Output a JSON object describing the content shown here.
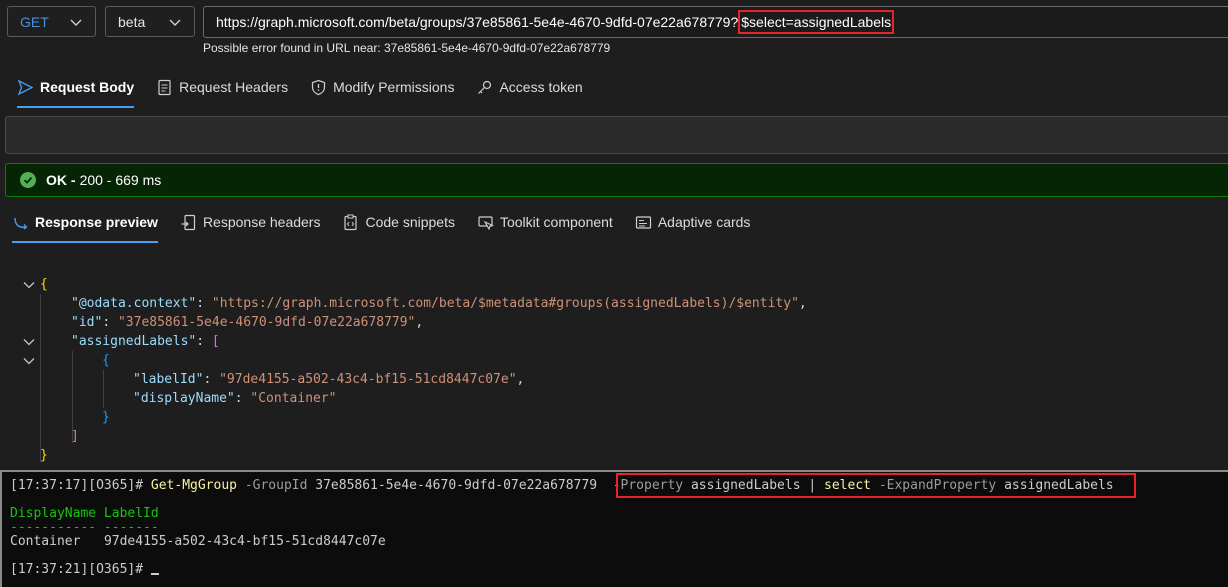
{
  "request": {
    "method": "GET",
    "version": "beta",
    "url_base": "https://graph.microsoft.com/beta/groups/37e85861-5e4e-4670-9dfd-07e22a678779?",
    "url_query": "$select=assignedLabels",
    "error_hint": "Possible error found in URL near: 37e85861-5e4e-4670-9dfd-07e22a678779"
  },
  "request_tabs": [
    "Request Body",
    "Request Headers",
    "Modify Permissions",
    "Access token"
  ],
  "status": {
    "bold": "OK -",
    "text": "200 - 669 ms"
  },
  "response_tabs": [
    "Response preview",
    "Response headers",
    "Code snippets",
    "Toolkit component",
    "Adaptive cards"
  ],
  "json": {
    "open": "{",
    "ctx_key": "\"@odata.context\"",
    "ctx_val": "\"https://graph.microsoft.com/beta/$metadata#groups(assignedLabels)/$entity\"",
    "id_key": "\"id\"",
    "id_val": "\"37e85861-5e4e-4670-9dfd-07e22a678779\"",
    "labels_key": "\"assignedLabels\"",
    "arr_open": "[",
    "obj_open": "{",
    "labelId_key": "\"labelId\"",
    "labelId_val": "\"97de4155-a502-43c4-bf15-51cd8447c07e\"",
    "dn_key": "\"displayName\"",
    "dn_val": "\"Container\"",
    "obj_close": "}",
    "arr_close": "]",
    "close": "}"
  },
  "terminal": {
    "prompt1": "[17:37:17][O365]# ",
    "cmd": "Get-MgGroup",
    "param1": "-GroupId",
    "arg1": "37e85861-5e4e-4670-9dfd-07e22a678779",
    "param2": "-Property",
    "arg2": "assignedLabels",
    "pipe": "|",
    "cmd2": "select",
    "param3": "-ExpandProperty",
    "arg3": "assignedLabels",
    "header": "DisplayName LabelId",
    "underline": "----------- -------",
    "row_name": "Container",
    "row_id": "97de4155-a502-43c4-bf15-51cd8447c07e",
    "prompt2": "[17:37:21][O365]# "
  }
}
